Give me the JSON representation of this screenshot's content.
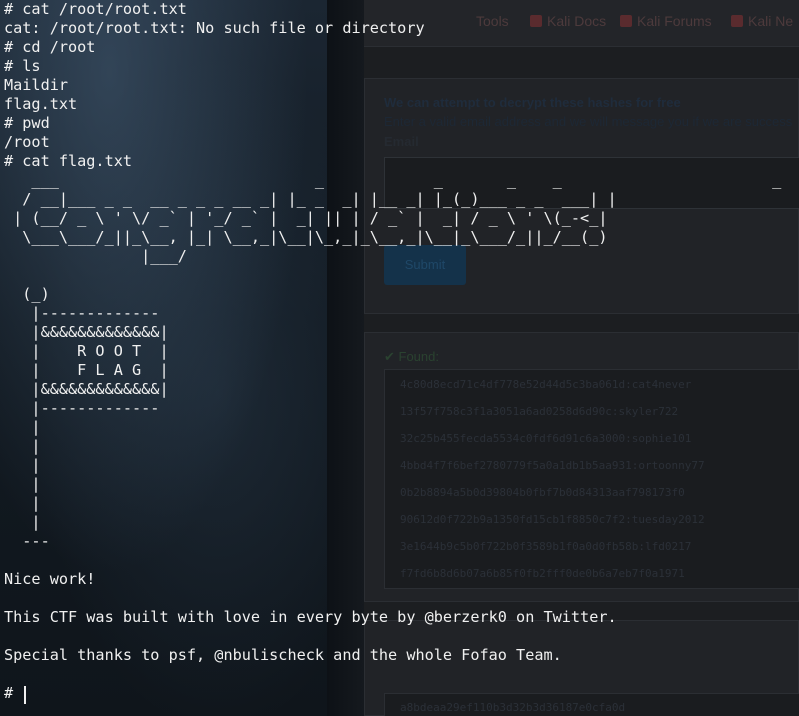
{
  "background_page": {
    "bookmarks": [
      "Tools",
      "Kali Docs",
      "Kali Forums",
      "Kali Ne"
    ],
    "form_card": {
      "title": "We can attempt to decrypt these hashes for free",
      "text": "Enter a valid email address and we will message you if we are success",
      "email_label": "Email",
      "submit_label": "Submit"
    },
    "found_card": {
      "label": "✔ Found:",
      "hashes": [
        "4c80d8ecd71c4df778e52d44d5c3ba061d:cat4never",
        "13f57f758c3f1a3051a6ad0258d6d90c:skyler722",
        "32c25b455fecda5534c0fdf6d91c6a3000:sophie101",
        "4bbd4f7f6bef2780779f5a0a1db1b5aa931:ortoonny77",
        "0b2b8894a5b0d39804b0fbf7b0d84313aaf798173f0",
        "90612d0f722b9a1350fd15cb1f8850c7f2:tuesday2012",
        "3e1644b9c5b0f722b0f3589b1f0a0d0fb58b:lfd0217",
        "f7fd6b8d6b07a6b85f0fb2fff0de0b6a7eb7f0a1971"
      ]
    },
    "bottom_card": {
      "hash": "a8bdeaa29ef110b3d32b3d36187e0cfa0d"
    }
  },
  "terminal": {
    "lines": [
      "# cat /root/root.txt",
      "cat: /root/root.txt: No such file or directory",
      "# cd /root",
      "# ls",
      "Maildir",
      "flag.txt",
      "# pwd",
      "/root",
      "# cat flag.txt",
      "   ___                            _            _       _    _                       _",
      "  / __|___ _ _  __ _ _ _ __ _| |_ _  _| |__ _| |_(_)___ _ _  ___| |",
      " | (__/ _ \\ ' \\/ _` | '_/ _` |  _| || | / _` |  _| / _ \\ ' \\(_-<_|",
      "  \\___\\___/_||_\\__, |_| \\__,_|\\__|\\_,_|_\\__,_|\\__|_\\___/_||_/__(_)",
      "               |___/",
      "",
      "  (_)",
      "   |-------------",
      "   |&&&&&&&&&&&&&|",
      "   |    R O O T  |",
      "   |    F L A G  |",
      "   |&&&&&&&&&&&&&|",
      "   |-------------",
      "   |",
      "   |",
      "   |",
      "   |",
      "   |",
      "   |",
      "  ---",
      "",
      "Nice work!",
      "",
      "This CTF was built with love in every byte by @berzerk0 on Twitter.",
      "",
      "Special thanks to psf, @nbulischeck and the whole Fofao Team.",
      "",
      "# "
    ]
  }
}
